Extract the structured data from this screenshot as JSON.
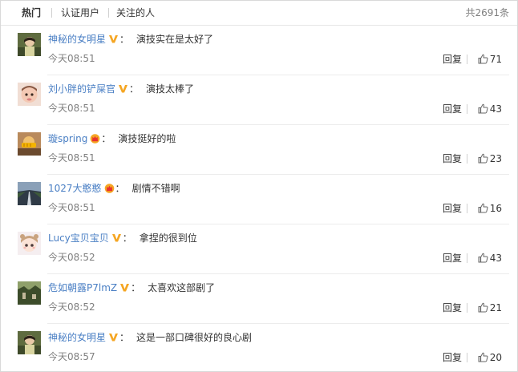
{
  "tabs": [
    "热门",
    "认证用户",
    "关注的人"
  ],
  "total_count": "共2691条",
  "reply_label": "回复",
  "colors": {
    "username": "#4a7fc4",
    "time": "#808080",
    "verified_badge": "#f5a623"
  },
  "comments": [
    {
      "user": "神秘的女明星",
      "badge": "verified-v-icon",
      "text": "演技实在是太好了",
      "time": "今天08:51",
      "likes": "71"
    },
    {
      "user": "刘小胖的铲屎官",
      "badge": "verified-v-icon",
      "text": "演技太棒了",
      "time": "今天08:51",
      "likes": "43"
    },
    {
      "user": "璇spring",
      "badge": "crown-vip-icon",
      "text": "演技挺好的啦",
      "time": "今天08:51",
      "likes": "23"
    },
    {
      "user": "1027大憨憨",
      "badge": "crown-vip-icon",
      "text": "剧情不错啊",
      "time": "今天08:51",
      "likes": "16"
    },
    {
      "user": "Lucy宝贝宝贝",
      "badge": "verified-v-icon",
      "text": "拿捏的很到位",
      "time": "今天08:52",
      "likes": "43"
    },
    {
      "user": "危如朝露P7lmZ",
      "badge": "verified-v-icon",
      "text": "太喜欢这部剧了",
      "time": "今天08:52",
      "likes": "21"
    },
    {
      "user": "神秘的女明星",
      "badge": "verified-v-icon",
      "text": "这是一部口碑很好的良心剧",
      "time": "今天08:57",
      "likes": "20"
    }
  ]
}
